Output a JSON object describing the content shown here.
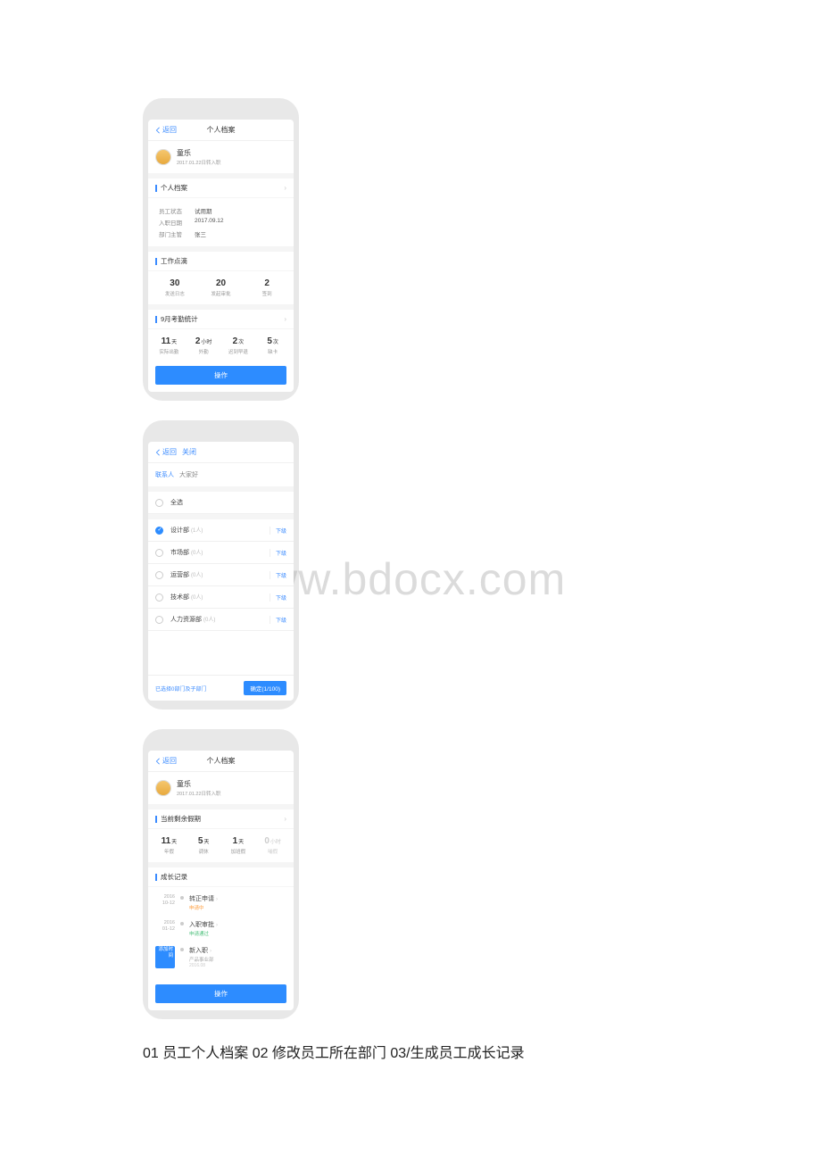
{
  "screen1": {
    "back": "返回",
    "title": "个人档案",
    "user": {
      "name": "童乐",
      "sub": "2017.01.22日转入职"
    },
    "section_profile": "个人档案",
    "kv": [
      {
        "k": "员工状态",
        "v": "试用期"
      },
      {
        "k": "入职日期",
        "v": "2017.09.12"
      },
      {
        "k": "部门主管",
        "v": "张三"
      }
    ],
    "section_work": "工作点滴",
    "work_stats": [
      {
        "num": "30",
        "unit": "",
        "label": "发送日志"
      },
      {
        "num": "20",
        "unit": "",
        "label": "发起审批"
      },
      {
        "num": "2",
        "unit": "",
        "label": "签到"
      }
    ],
    "section_attend": "9月考勤统计",
    "attend_stats": [
      {
        "num": "11",
        "unit": "天",
        "label": "实际出勤"
      },
      {
        "num": "2",
        "unit": "小时",
        "label": "外勤"
      },
      {
        "num": "2",
        "unit": "次",
        "label": "迟到早退"
      },
      {
        "num": "5",
        "unit": "次",
        "label": "缺卡"
      }
    ],
    "action": "操作"
  },
  "screen2": {
    "back": "返回",
    "close": "关闭",
    "contact_label": "联系人",
    "contact_value": "大家好",
    "select_all": "全选",
    "depts": [
      {
        "name": "设计部",
        "count": "(1人)",
        "checked": true,
        "sub": "下级"
      },
      {
        "name": "市场部",
        "count": "(0人)",
        "checked": false,
        "sub": "下级"
      },
      {
        "name": "运营部",
        "count": "(0人)",
        "checked": false,
        "sub": "下级"
      },
      {
        "name": "技术部",
        "count": "(0人)",
        "checked": false,
        "sub": "下级"
      },
      {
        "name": "人力资源部",
        "count": "(0人)",
        "checked": false,
        "sub": "下级"
      }
    ],
    "footer_left": "已选择0部门及子部门",
    "footer_btn": "确定(1/100)"
  },
  "screen3": {
    "back": "返回",
    "title": "个人档案",
    "user": {
      "name": "童乐",
      "sub": "2017.01.22日转入职"
    },
    "section_leave": "当前剩余假期",
    "leave_stats": [
      {
        "num": "11",
        "unit": "天",
        "label": "年假",
        "dim": false
      },
      {
        "num": "5",
        "unit": "天",
        "label": "调休",
        "dim": false
      },
      {
        "num": "1",
        "unit": "天",
        "label": "加班假",
        "dim": false
      },
      {
        "num": "0",
        "unit": "小时",
        "label": "哺假",
        "dim": true
      }
    ],
    "section_growth": "成长记录",
    "timeline": [
      {
        "date_l1": "2016",
        "date_l2": "10-12",
        "badge": false,
        "title": "转正申请",
        "sub": "申请中",
        "sub_class": "orange",
        "sub2": ""
      },
      {
        "date_l1": "2016",
        "date_l2": "01-12",
        "badge": false,
        "title": "入职审批",
        "sub": "申请通过",
        "sub_class": "green",
        "sub2": ""
      },
      {
        "date_l1": "添加时间",
        "date_l2": "",
        "badge": true,
        "title": "新入职",
        "sub": "产品事业部",
        "sub_class": "gray",
        "sub2": "2016.08"
      }
    ],
    "action": "操作"
  },
  "caption": "01 员工个人档案 02 修改员工所在部门 03/生成员工成长记录",
  "watermark": "www.bdocx.com"
}
